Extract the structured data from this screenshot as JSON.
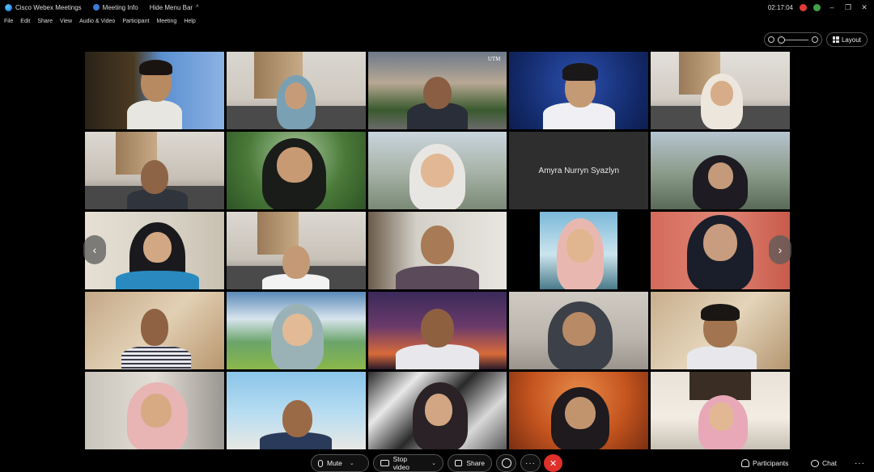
{
  "titlebar": {
    "app_name": "Cisco Webex Meetings",
    "meeting_info": "Meeting Info",
    "hide_menu_bar": "Hide Menu Bar",
    "time": "02:17:04",
    "hide_chevron": "^"
  },
  "menu": {
    "items": [
      "File",
      "Edit",
      "Share",
      "View",
      "Audio & Video",
      "Participant",
      "Meeting",
      "Help"
    ]
  },
  "view_controls": {
    "layout_label": "Layout"
  },
  "grid": {
    "placeholder_name": "Amyra Nurryn Syazlyn",
    "watermark": "UTM"
  },
  "nav": {
    "prev": "‹",
    "next": "›"
  },
  "controls": {
    "mute_label": "Mute",
    "stop_video_label": "Stop video",
    "share_label": "Share",
    "more_label": "···",
    "end_label": "✕",
    "participants_label": "Participants",
    "chat_label": "Chat",
    "overflow_label": "···"
  },
  "colors": {
    "end_meeting": "#e0302a",
    "recording": "#e53935",
    "connection": "#43a047"
  }
}
